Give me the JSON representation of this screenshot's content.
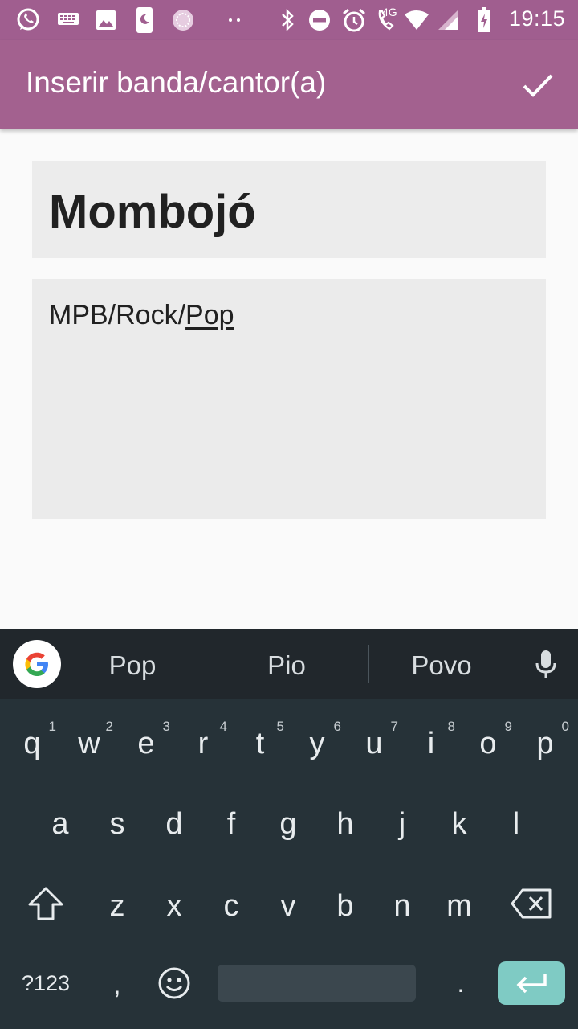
{
  "status_bar": {
    "time": "19:15",
    "network": "4G",
    "icons": [
      "whatsapp-icon",
      "keyboard-icon",
      "image-icon",
      "phone-moon-icon",
      "circle-app-icon",
      "more-dots-icon",
      "bluetooth-icon",
      "do-not-disturb-icon",
      "alarm-icon",
      "call-4g-icon",
      "wifi-icon",
      "signal-icon",
      "battery-charging-icon"
    ]
  },
  "app_bar": {
    "title": "Inserir banda/cantor(a)",
    "confirm_icon": "check-icon"
  },
  "form": {
    "band_name": "Mombojó",
    "genre_prefix": "MPB/Rock/",
    "genre_composing": "Pop"
  },
  "keyboard": {
    "suggestions": [
      "Pop",
      "Pio",
      "Povo"
    ],
    "row1": [
      {
        "ch": "q",
        "hint": "1"
      },
      {
        "ch": "w",
        "hint": "2"
      },
      {
        "ch": "e",
        "hint": "3"
      },
      {
        "ch": "r",
        "hint": "4"
      },
      {
        "ch": "t",
        "hint": "5"
      },
      {
        "ch": "y",
        "hint": "6"
      },
      {
        "ch": "u",
        "hint": "7"
      },
      {
        "ch": "i",
        "hint": "8"
      },
      {
        "ch": "o",
        "hint": "9"
      },
      {
        "ch": "p",
        "hint": "0"
      }
    ],
    "row2": [
      "a",
      "s",
      "d",
      "f",
      "g",
      "h",
      "j",
      "k",
      "l"
    ],
    "row3": [
      "z",
      "x",
      "c",
      "v",
      "b",
      "n",
      "m"
    ],
    "symbols_label": "?123",
    "comma": ",",
    "period": ".",
    "colors": {
      "background": "#263238",
      "enter": "#7fcbc4"
    }
  },
  "colors": {
    "app_bar": "#a3618f",
    "status_bar": "#a05e8f",
    "field": "#ececec"
  }
}
